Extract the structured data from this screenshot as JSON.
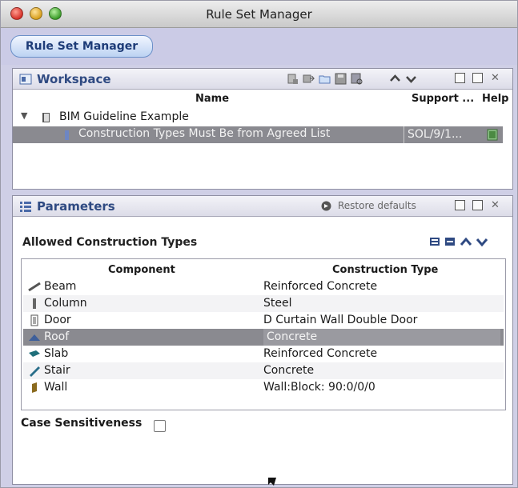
{
  "window": {
    "title": "Rule Set Manager"
  },
  "tab": {
    "label": "Rule Set Manager"
  },
  "workspace": {
    "title": "Workspace",
    "columns": {
      "name": "Name",
      "support": "Support ...",
      "help": "Help"
    },
    "tree": {
      "group": "BIM Guideline Example",
      "rule": "Construction Types Must Be from Agreed List",
      "rule_support": "SOL/9/1..."
    }
  },
  "parameters": {
    "title": "Parameters",
    "restore_label": "Restore defaults",
    "section_label": "Allowed Construction Types",
    "columns": {
      "component": "Component",
      "construction_type": "Construction Type"
    },
    "rows": [
      {
        "component": "Beam",
        "type": "Reinforced Concrete",
        "icon": "beam-icon"
      },
      {
        "component": "Column",
        "type": "Steel",
        "icon": "column-icon"
      },
      {
        "component": "Door",
        "type": "D Curtain Wall Double Door",
        "icon": "door-icon"
      },
      {
        "component": "Roof",
        "type": "Concrete",
        "icon": "roof-icon"
      },
      {
        "component": "Slab",
        "type": "Reinforced Concrete",
        "icon": "slab-icon"
      },
      {
        "component": "Stair",
        "type": "Concrete",
        "icon": "stair-icon"
      },
      {
        "component": "Wall",
        "type": "Wall:Block: 90:0/0/0",
        "icon": "wall-icon"
      }
    ],
    "case_label": "Case Sensitiveness",
    "case_checked": false
  },
  "colors": {
    "accent": "#2f4a82",
    "selection": "#8a8a90",
    "frame": "#cfcfe6"
  }
}
